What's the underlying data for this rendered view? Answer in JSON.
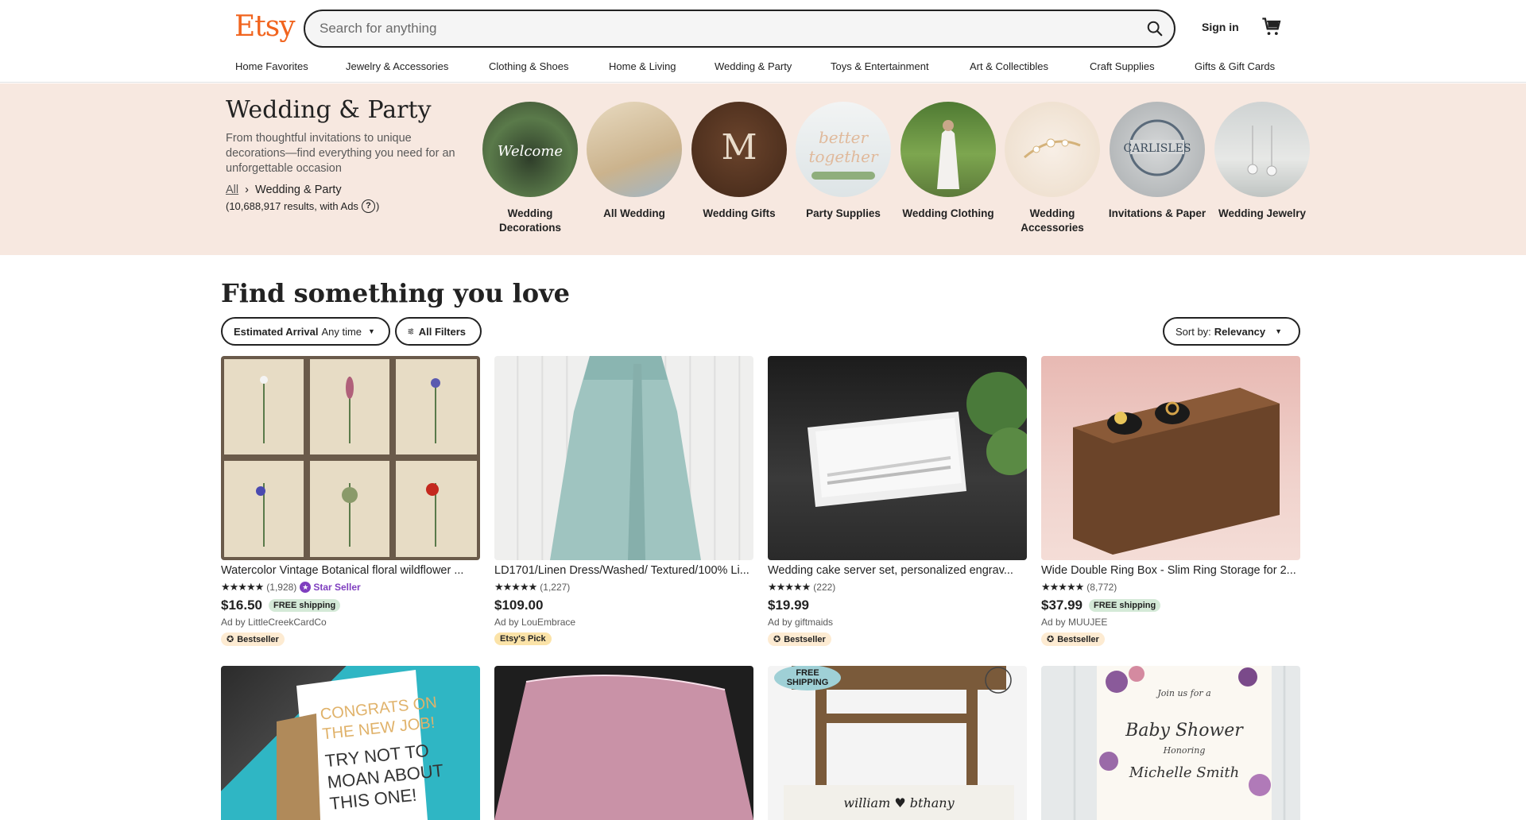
{
  "header": {
    "logo": "Etsy",
    "search_placeholder": "Search for anything",
    "sign_in": "Sign in",
    "categories": [
      "Home Favorites",
      "Jewelry & Accessories",
      "Clothing & Shoes",
      "Home & Living",
      "Wedding & Party",
      "Toys & Entertainment",
      "Art & Collectibles",
      "Craft Supplies",
      "Gifts & Gift Cards"
    ]
  },
  "banner": {
    "title": "Wedding & Party",
    "description": "From thoughtful invitations to unique decorations—find everything you need for an unforgettable occasion",
    "breadcrumb_all": "All",
    "breadcrumb_sep": "›",
    "breadcrumb_current": "Wedding & Party",
    "results": "(10,688,917 results, with Ads",
    "results_close": ")",
    "help_icon": "?",
    "subcategories": [
      {
        "label": "Wedding Decorations",
        "color": "#3f5a38"
      },
      {
        "label": "All Wedding",
        "color": "#d9c6a8"
      },
      {
        "label": "Wedding Gifts",
        "color": "#5c3a28"
      },
      {
        "label": "Party Supplies",
        "color": "#e8ecee"
      },
      {
        "label": "Wedding Clothing",
        "color": "#6f8f4a"
      },
      {
        "label": "Wedding Accessories",
        "color": "#f1e6dc"
      },
      {
        "label": "Invitations & Paper",
        "color": "#c9ccce"
      },
      {
        "label": "Wedding Jewelry",
        "color": "#d6d8d8"
      }
    ]
  },
  "main": {
    "heading": "Find something you love",
    "filters": {
      "arrival_label": "Estimated Arrival",
      "arrival_value": "Any time",
      "all_filters": "All Filters",
      "sort_label": "Sort by:",
      "sort_value": "Relevancy"
    },
    "listings": [
      {
        "title": "Watercolor Vintage Botanical floral wildflower ...",
        "stars": "★★★★★",
        "reviews": "(1,928)",
        "star_seller": "Star Seller",
        "price": "$16.50",
        "free_shipping": "FREE shipping",
        "seller": "Ad by LittleCreekCardCo",
        "badge": "Bestseller"
      },
      {
        "title": "LD1701/Linen Dress/Washed/ Textured/100% Li...",
        "stars": "★★★★★",
        "reviews": "(1,227)",
        "star_seller": "",
        "price": "$109.00",
        "free_shipping": "",
        "seller": "Ad by LouEmbrace",
        "badge": "Etsy's Pick"
      },
      {
        "title": "Wedding cake server set, personalized engrav...",
        "stars": "★★★★★",
        "reviews": "(222)",
        "star_seller": "",
        "price": "$19.99",
        "free_shipping": "",
        "seller": "Ad by giftmaids",
        "badge": "Bestseller"
      },
      {
        "title": "Wide Double Ring Box - Slim Ring Storage for 2...",
        "stars": "★★★★★",
        "reviews": "(8,772)",
        "star_seller": "",
        "price": "$37.99",
        "free_shipping": "FREE shipping",
        "seller": "Ad by MUUJEE",
        "badge": "Bestseller"
      }
    ],
    "row2_texts": {
      "card1": [
        "CONGRATS ON",
        "THE NEW JOB!",
        "TRY NOT TO",
        "MOAN ABOUT",
        "THIS ONE!"
      ],
      "card3_badge": [
        "FREE",
        "SHIPPING"
      ],
      "card3_pillow": "william ♥ bthany",
      "card4": [
        "Join us for a",
        "Baby Shower",
        "Honoring",
        "Michelle Smith"
      ]
    }
  }
}
